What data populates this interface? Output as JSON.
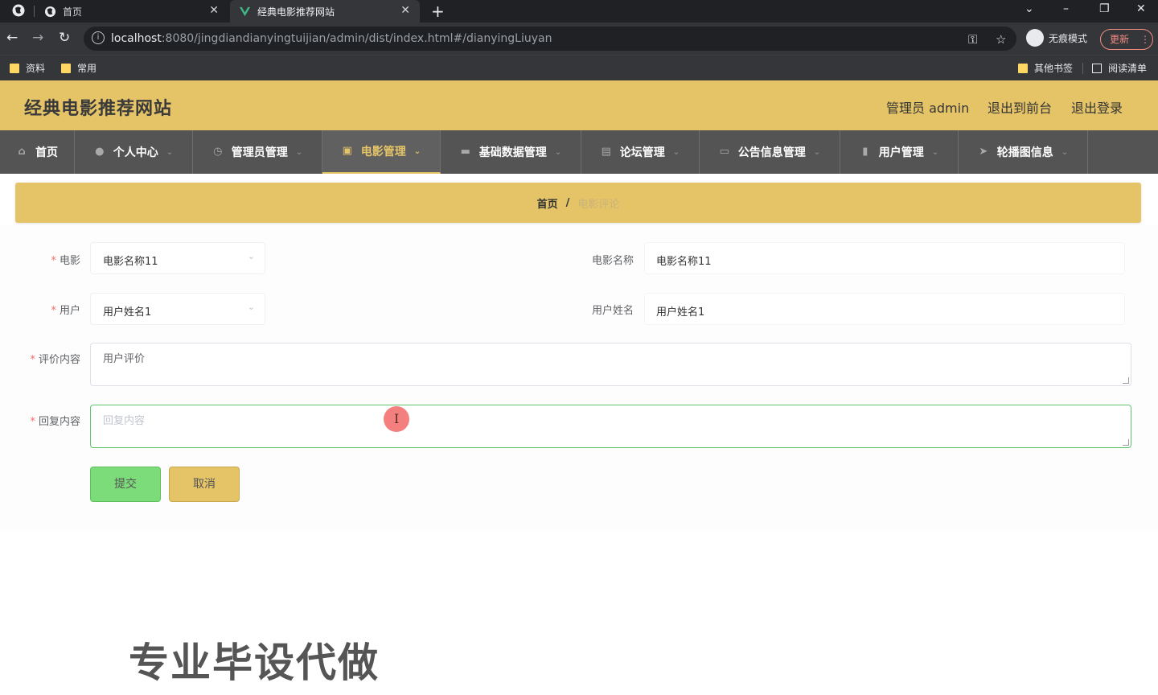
{
  "browser": {
    "tabs": [
      {
        "title": "首页",
        "active": false
      },
      {
        "title": "经典电影推荐网站",
        "active": true
      }
    ],
    "url_host": "localhost",
    "url_rest": ":8080/jingdiandianyingtuijian/admin/dist/index.html#/dianyingLiuyan",
    "incognito_label": "无痕模式",
    "update_label": "更新",
    "bookmarks": {
      "left": [
        "资料",
        "常用"
      ],
      "right": [
        "其他书签",
        "阅读清单"
      ]
    }
  },
  "header": {
    "site_title": "经典电影推荐网站",
    "admin_label": "管理员 admin",
    "to_front": "退出到前台",
    "logout": "退出登录"
  },
  "menu": [
    {
      "label": "首页",
      "icon": "home-icon",
      "active": false,
      "has_caret": false
    },
    {
      "label": "个人中心",
      "icon": "user-icon",
      "active": false,
      "has_caret": true
    },
    {
      "label": "管理员管理",
      "icon": "clock-icon",
      "active": false,
      "has_caret": true
    },
    {
      "label": "电影管理",
      "icon": "film-icon",
      "active": true,
      "has_caret": true
    },
    {
      "label": "基础数据管理",
      "icon": "briefcase-icon",
      "active": false,
      "has_caret": true
    },
    {
      "label": "论坛管理",
      "icon": "document-icon",
      "active": false,
      "has_caret": true
    },
    {
      "label": "公告信息管理",
      "icon": "monitor-icon",
      "active": false,
      "has_caret": true
    },
    {
      "label": "用户管理",
      "icon": "bar-chart-icon",
      "active": false,
      "has_caret": true
    },
    {
      "label": "轮播图信息",
      "icon": "send-icon",
      "active": false,
      "has_caret": true
    }
  ],
  "breadcrumb": {
    "home": "首页",
    "separator": "/",
    "current": "电影评论"
  },
  "form": {
    "movie_label": "电影",
    "movie_value": "电影名称11",
    "movie_name_label": "电影名称",
    "movie_name_value": "电影名称11",
    "user_label": "用户",
    "user_value": "用户姓名1",
    "user_name_label": "用户姓名",
    "user_name_value": "用户姓名1",
    "review_label": "评价内容",
    "review_value": "用户评价",
    "reply_label": "回复内容",
    "reply_placeholder": "回复内容",
    "submit_label": "提交",
    "cancel_label": "取消"
  },
  "watermark_text": "专业毕设代做",
  "colors": {
    "accent": "#e5c468",
    "menu_bg": "#545454",
    "submit_green": "#7ddc7a",
    "required_red": "#f56c6c"
  }
}
